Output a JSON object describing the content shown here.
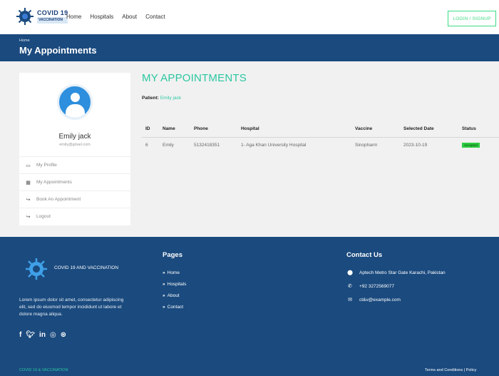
{
  "navbar": {
    "logo_line1": "COVID 19",
    "logo_line2": "VACCINATION",
    "links": [
      "Home",
      "Hospitals",
      "About",
      "Contact"
    ],
    "login_label": "LOGIN / SIGNUP"
  },
  "header": {
    "breadcrumb": "Home",
    "title": "My Appointments"
  },
  "sidebar": {
    "user_name": "Emily jack",
    "user_email": "emily@gmail.com",
    "menu": [
      {
        "label": "My Profile",
        "icon": "id-card-icon"
      },
      {
        "label": "My Appointments",
        "icon": "calendar-icon"
      },
      {
        "label": "Book An Appointment",
        "icon": "sign-in-icon"
      },
      {
        "label": "Logout",
        "icon": "sign-out-icon"
      }
    ]
  },
  "main": {
    "title": "MY APPOINTMENTS",
    "patient_label": "Patient:",
    "patient_name": "Emily jack",
    "table": {
      "headers": [
        "ID",
        "Name",
        "Phone",
        "Hospital",
        "Vaccine",
        "Selected Date",
        "Status"
      ],
      "rows": [
        {
          "id": "6",
          "name": "Emily",
          "phone": "5132418351",
          "hospital": "1- Aga Khan University Hospital",
          "vaccine": "Sinopharm",
          "date": "2023-10-19",
          "status": "Accepted"
        }
      ]
    }
  },
  "footer": {
    "brand": "COVID 19 AND VACCINATION",
    "description": "Lorem ipsum dolor sit amet, consectetur adipiscing elit, sed do eiusmod tempor incididunt ut labore et dolore magna aliqua.",
    "social": [
      "f",
      "t",
      "in",
      "ig",
      "dr"
    ],
    "pages_heading": "Pages",
    "pages": [
      "Home",
      "Hospitals",
      "About",
      "Contact"
    ],
    "contact_heading": "Contact Us",
    "address": "Aptech Metro Star Gate Karachi, Pakistan",
    "phone": "+92 3272569077",
    "email": "ct&v@example.com",
    "copyright": "COVID 19 & VACCINATION",
    "legal": "Terms and Conditions  |  Policy"
  },
  "colors": {
    "primary": "#1a4a7e",
    "accent": "#2bc7a0",
    "badge": "#2ecc40",
    "avatar": "#2d8fdd"
  }
}
